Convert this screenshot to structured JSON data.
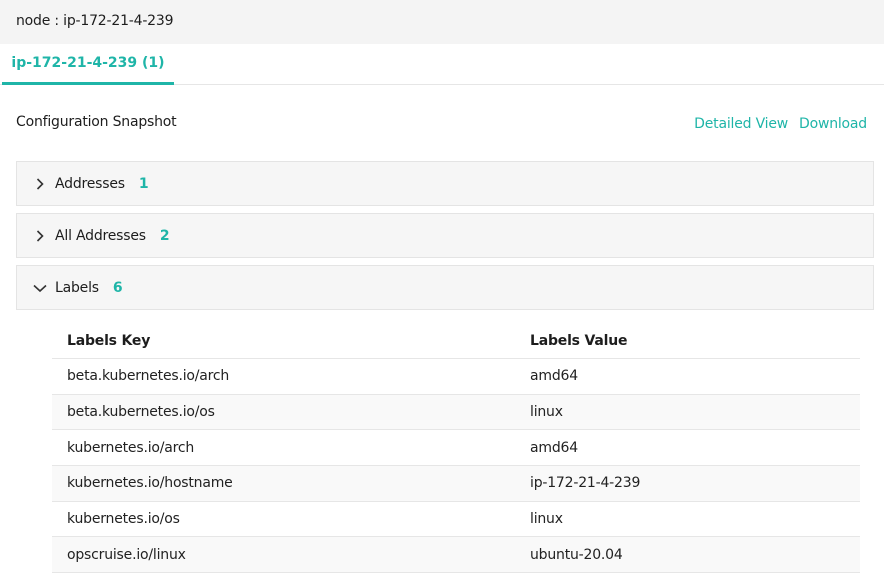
{
  "header": {
    "title": "node : ip-172-21-4-239"
  },
  "tabs": [
    {
      "label": "ip-172-21-4-239 (1)"
    }
  ],
  "snapshot": {
    "title": "Configuration Snapshot",
    "detailed_view_label": "Detailed View",
    "download_label": "Download"
  },
  "sections": [
    {
      "label": "Addresses",
      "count": "1",
      "expanded": false
    },
    {
      "label": "All Addresses",
      "count": "2",
      "expanded": false
    },
    {
      "label": "Labels",
      "count": "6",
      "expanded": true
    }
  ],
  "labels_table": {
    "columns": [
      "Labels Key",
      "Labels Value"
    ],
    "rows": [
      [
        "beta.kubernetes.io/arch",
        "amd64"
      ],
      [
        "beta.kubernetes.io/os",
        "linux"
      ],
      [
        "kubernetes.io/arch",
        "amd64"
      ],
      [
        "kubernetes.io/hostname",
        "ip-172-21-4-239"
      ],
      [
        "kubernetes.io/os",
        "linux"
      ],
      [
        "opscruise.io/linux",
        "ubuntu-20.04"
      ]
    ]
  },
  "colors": {
    "accent": "#1fb5a8",
    "header_bg": "#f4f4f4",
    "section_bg": "#f6f6f6"
  },
  "icons": {
    "collapsed": "chevron-right-icon",
    "expanded": "chevron-down-icon"
  }
}
